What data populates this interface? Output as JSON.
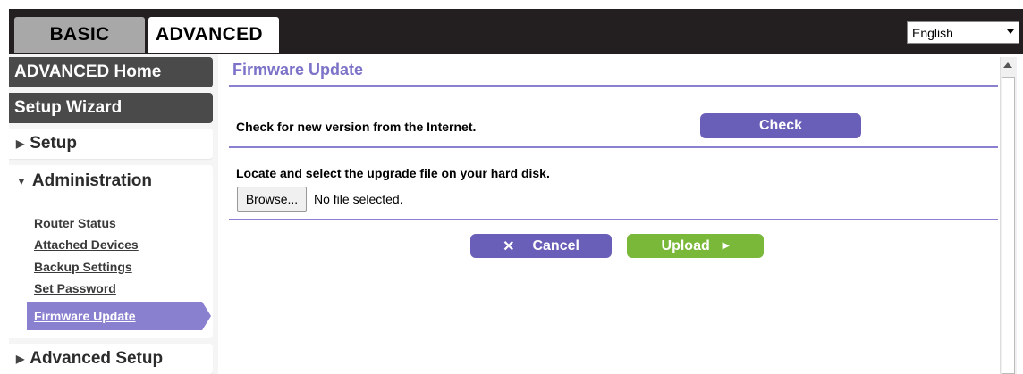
{
  "header": {
    "tabs": [
      {
        "label": "BASIC"
      },
      {
        "label": "ADVANCED"
      }
    ],
    "language": {
      "selected": "English"
    }
  },
  "sidebar": {
    "advanced_home": "ADVANCED Home",
    "setup_wizard": "Setup Wizard",
    "setup": "Setup",
    "administration": "Administration",
    "admin_items": [
      "Router Status",
      "Attached Devices",
      "Backup Settings",
      "Set Password",
      "Firmware Update"
    ],
    "advanced_setup": "Advanced Setup"
  },
  "main": {
    "title": "Firmware Update",
    "check_label": "Check for new version from the Internet.",
    "check_button": "Check",
    "locate_label": "Locate and select the upgrade file on your hard disk.",
    "browse_button": "Browse...",
    "file_status": "No file selected.",
    "cancel_button": "Cancel",
    "upload_button": "Upload"
  },
  "colors": {
    "accent_purple": "#6a5fb8",
    "active_nav": "#8a80d0",
    "upload_green": "#7ab83a",
    "header_dark": "#231f20"
  }
}
